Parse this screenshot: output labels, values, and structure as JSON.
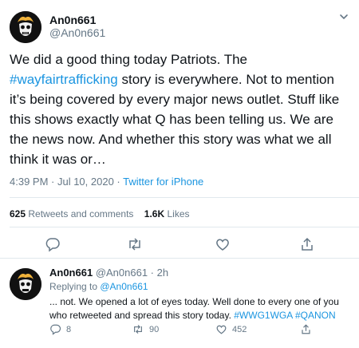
{
  "tweet": {
    "display_name": "An0n661",
    "handle": "@An0n661",
    "text_1": "We did a good thing today Patriots. The ",
    "hashtag": "#wayfairtrafficking",
    "text_2": " story is everywhere. Not to mention it’s being covered by every major news outlet. Stuff like this shows exactly what Q has been telling us. We are the news now. And whether this story was what we all think it was or…",
    "time": "4:39 PM · Jul 10, 2020 · ",
    "source": "Twitter for iPhone",
    "retweets_count": "625",
    "retweets_label": " Retweets and comments",
    "likes_count": "1.6K",
    "likes_label": " Likes",
    "actions": [
      "reply-icon",
      "retweet-icon",
      "like-icon",
      "share-icon"
    ]
  },
  "reply": {
    "display_name": "An0n661",
    "handle_time": " @An0n661 · 2h",
    "replying_prefix": "Replying to ",
    "replying_handle": "@An0n661",
    "text": "... not. We opened a lot of eyes today. Well done to every one of you who retweeted and spread this story today. ",
    "hashtag_1": "#WWG1WGA",
    "hashtag_2": "#QANON",
    "reply_count": "8",
    "retweet_count": "90",
    "like_count": "452"
  },
  "colors": {
    "link": "#1b95e0",
    "gray": "#657786",
    "text": "#0f1419",
    "avatar_hair": "#f0b23a"
  }
}
